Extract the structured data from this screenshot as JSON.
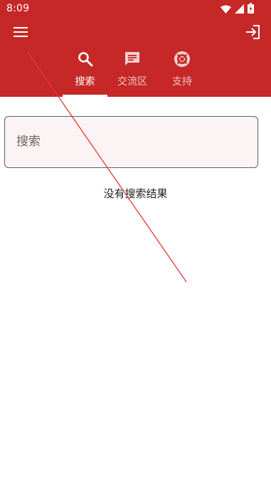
{
  "status_bar": {
    "time": "8:09",
    "icons": [
      "wifi-icon",
      "signal-icon",
      "battery-charging-icon"
    ]
  },
  "toolbar": {
    "menu_icon": "hamburger-menu-icon",
    "login_icon": "login-icon"
  },
  "tabs": [
    {
      "label": "搜索",
      "icon": "search-icon",
      "active": true
    },
    {
      "label": "交流区",
      "icon": "chat-icon",
      "active": false
    },
    {
      "label": "支持",
      "icon": "lifebuoy-icon",
      "active": false
    }
  ],
  "search": {
    "placeholder": "搜索",
    "value": ""
  },
  "results": {
    "empty_text": "没有搜索结果"
  },
  "colors": {
    "primary": "#c62828",
    "on_primary": "#ffffff",
    "input_background": "#fcf4f4",
    "annotation_line": "#e53935"
  }
}
